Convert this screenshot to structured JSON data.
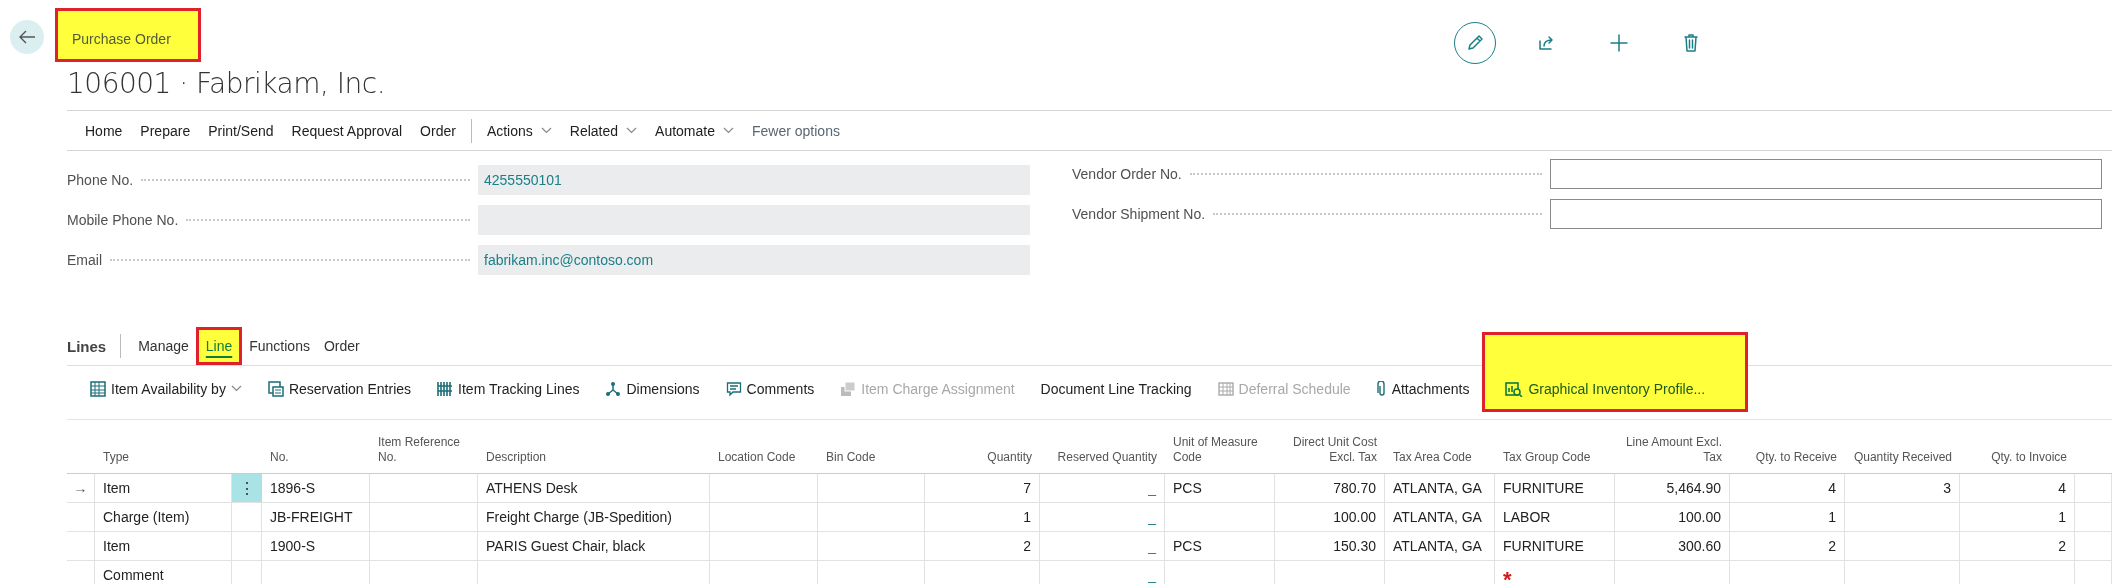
{
  "header": {
    "breadcrumb": "Purchase Order",
    "breadcrumb_highlighted": true,
    "title": "106001 · Fabrikam, Inc."
  },
  "action_bar": [
    {
      "label": "Home",
      "kind": "tab"
    },
    {
      "label": "Prepare",
      "kind": "tab"
    },
    {
      "label": "Print/Send",
      "kind": "tab"
    },
    {
      "label": "Request Approval",
      "kind": "tab"
    },
    {
      "label": "Order",
      "kind": "tab"
    },
    {
      "label": "Actions",
      "kind": "menu"
    },
    {
      "label": "Related",
      "kind": "menu"
    },
    {
      "label": "Automate",
      "kind": "menu"
    },
    {
      "label": "Fewer options",
      "kind": "link"
    }
  ],
  "form": {
    "left": [
      {
        "label": "Phone No.",
        "value": "4255550101",
        "editable": false
      },
      {
        "label": "Mobile Phone No.",
        "editable": false
      },
      {
        "label": "Email",
        "value": "fabrikam.inc@contoso.com",
        "editable": false
      }
    ],
    "right": [
      {
        "label": "Vendor Order No.",
        "editable": true
      },
      {
        "label": "Vendor Shipment No.",
        "editable": true
      }
    ]
  },
  "lines": {
    "title": "Lines",
    "tabs": [
      {
        "label": "Manage",
        "selected": false,
        "highlighted": false
      },
      {
        "label": "Line",
        "selected": true,
        "highlighted": true
      },
      {
        "label": "Functions",
        "selected": false,
        "highlighted": false
      },
      {
        "label": "Order",
        "selected": false,
        "highlighted": false
      }
    ],
    "actions": [
      {
        "label": "Item Availability by",
        "dropdown": true,
        "disabled": false,
        "highlighted": false
      },
      {
        "label": "Reservation Entries",
        "dropdown": false,
        "disabled": false,
        "highlighted": false
      },
      {
        "label": "Item Tracking Lines",
        "dropdown": false,
        "disabled": false,
        "highlighted": false
      },
      {
        "label": "Dimensions",
        "dropdown": false,
        "disabled": false,
        "highlighted": false
      },
      {
        "label": "Comments",
        "dropdown": false,
        "disabled": false,
        "highlighted": false
      },
      {
        "label": "Item Charge Assignment",
        "dropdown": false,
        "disabled": true,
        "highlighted": false
      },
      {
        "label": "Document Line Tracking",
        "dropdown": false,
        "disabled": false,
        "highlighted": false
      },
      {
        "label": "Deferral Schedule",
        "dropdown": false,
        "disabled": true,
        "highlighted": false
      },
      {
        "label": "Attachments",
        "dropdown": false,
        "disabled": false,
        "highlighted": false
      },
      {
        "label": "Graphical Inventory Profile...",
        "dropdown": false,
        "disabled": false,
        "highlighted": true
      }
    ],
    "table": {
      "columns": [
        {
          "label": "Type",
          "kind": "text"
        },
        {
          "label": "No.",
          "kind": "text"
        },
        {
          "label": "Item Reference No.",
          "kind": "text"
        },
        {
          "label": "Description",
          "kind": "text"
        },
        {
          "label": "Location Code",
          "kind": "text"
        },
        {
          "label": "Bin Code",
          "kind": "text"
        },
        {
          "label": "Quantity",
          "kind": "text"
        },
        {
          "label": "Reserved Quantity",
          "kind": "link"
        },
        {
          "label": "Unit of Measure Code",
          "kind": "text"
        },
        {
          "label": "Direct Unit Cost Excl. Tax",
          "kind": "text"
        },
        {
          "label": "Tax Area Code",
          "kind": "text"
        },
        {
          "label": "Tax Group Code",
          "kind": "text"
        },
        {
          "label": "Line Amount Excl. Tax",
          "kind": "text"
        },
        {
          "label": "Qty. to Receive",
          "kind": "text"
        },
        {
          "label": "Quantity Received",
          "kind": "text"
        },
        {
          "label": "Qty. to Invoice",
          "kind": "text"
        }
      ],
      "rows": [
        {
          "indicator": "→",
          "menu": "⋮",
          "cells": [
            "Item",
            "1896-S",
            "",
            "ATHENS Desk",
            "",
            "",
            "7",
            "_",
            "PCS",
            "780.70",
            "ATLANTA, GA",
            "FURNITURE",
            "5,464.90",
            "4",
            "3",
            "4"
          ]
        },
        {
          "cells": [
            "Charge (Item)",
            "JB-FREIGHT",
            "",
            "Freight Charge (JB-Spedition)",
            "",
            "",
            "1",
            "_",
            "",
            "100.00",
            "ATLANTA, GA",
            "LABOR",
            "100.00",
            "1",
            "",
            "1"
          ]
        },
        {
          "cells": [
            "Item",
            "1900-S",
            "",
            "PARIS Guest Chair, black",
            "",
            "",
            "2",
            "_",
            "PCS",
            "150.30",
            "ATLANTA, GA",
            "FURNITURE",
            "300.60",
            "2",
            "",
            "2"
          ]
        },
        {
          "cells": [
            "Comment",
            "",
            "",
            "",
            "",
            "",
            "",
            "_",
            "",
            "",
            "",
            {
              "text": "*",
              "kind": "required"
            },
            "",
            "",
            "",
            ""
          ]
        }
      ]
    }
  }
}
